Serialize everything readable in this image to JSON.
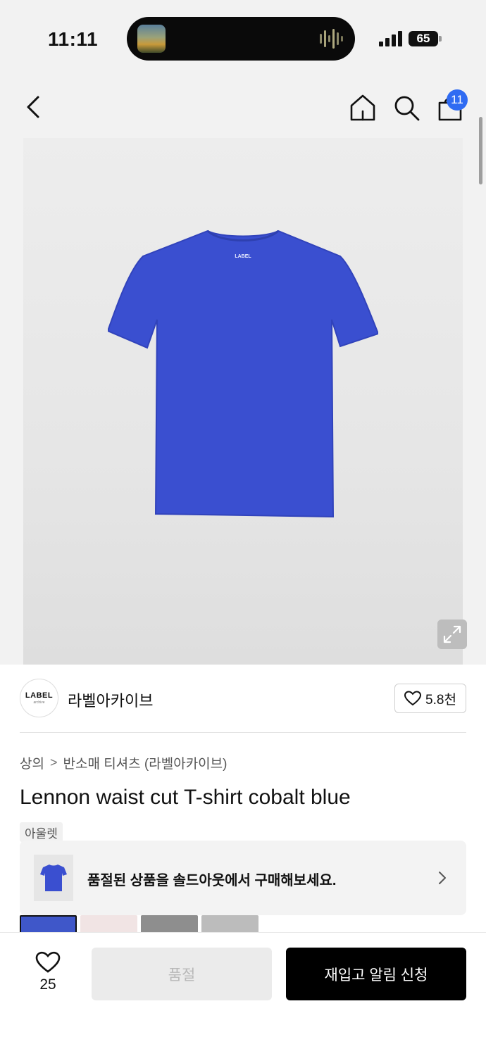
{
  "status_bar": {
    "time": "11:11",
    "battery": "65"
  },
  "header": {
    "cart_badge": "11",
    "icons": [
      "back-icon",
      "home-icon",
      "search-icon",
      "shopping-bag-icon"
    ]
  },
  "product_image": {
    "color": "#3a4fd0",
    "brand_print": "LABEL"
  },
  "brand": {
    "logo_text": "LABEL",
    "logo_sub": "archive",
    "name": "라벨아카이브",
    "likes": "5.8천"
  },
  "breadcrumb": {
    "category": "상의",
    "separator": ">",
    "subcategory": "반소매 티셔츠 (라벨아카이브)"
  },
  "product": {
    "title": "Lennon waist cut T-shirt cobalt blue",
    "tag": "아울렛"
  },
  "soldout_banner": {
    "text": "품절된 상품을 솔드아웃에서 구매해보세요."
  },
  "color_swatches": [
    {
      "color": "#3f57c9"
    },
    {
      "color": "#f1e4e4"
    },
    {
      "color": "#8e8e8e"
    },
    {
      "color": "#bcbcbc"
    }
  ],
  "bottom_bar": {
    "wish_count": "25",
    "soldout_label": "품절",
    "restock_label": "재입고 알림 신청"
  },
  "colors": {
    "badge": "#2f6bf2",
    "primary_button": "#000000",
    "disabled_button": "#ebebeb"
  }
}
